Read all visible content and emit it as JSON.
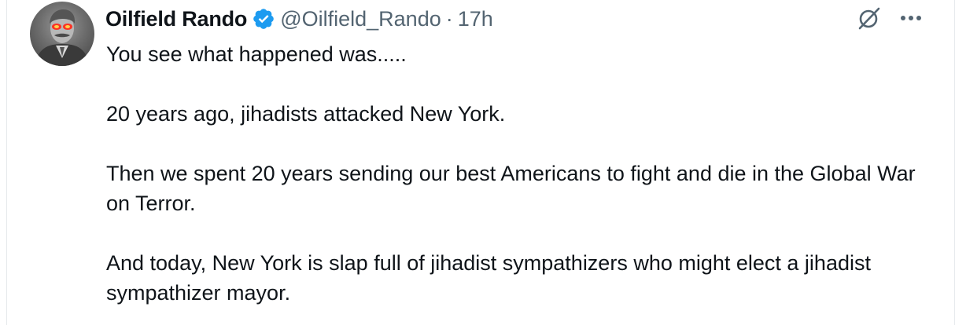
{
  "author": {
    "display_name": "Oilfield Rando",
    "handle": "@Oilfield_Rando",
    "separator": "·",
    "timestamp": "17h",
    "verified": true,
    "avatar_icon": "profile-photo-red-eyes",
    "verified_color": "#1d9bf0"
  },
  "actions": {
    "grok_icon": "grok-icon",
    "more_icon": "more-horizontal-icon",
    "more_label": "···"
  },
  "post": {
    "paragraphs": [
      "You see what happened was.....",
      "20 years ago, jihadists attacked New York.",
      "Then we spent 20 years sending our best Americans to fight and die in the Global War on Terror.",
      "And today, New York is slap full of jihadist sympathizers who might elect a jihadist sympathizer mayor."
    ]
  },
  "colors": {
    "text": "#0f1419",
    "secondary": "#536471",
    "accent": "#1d9bf0"
  }
}
